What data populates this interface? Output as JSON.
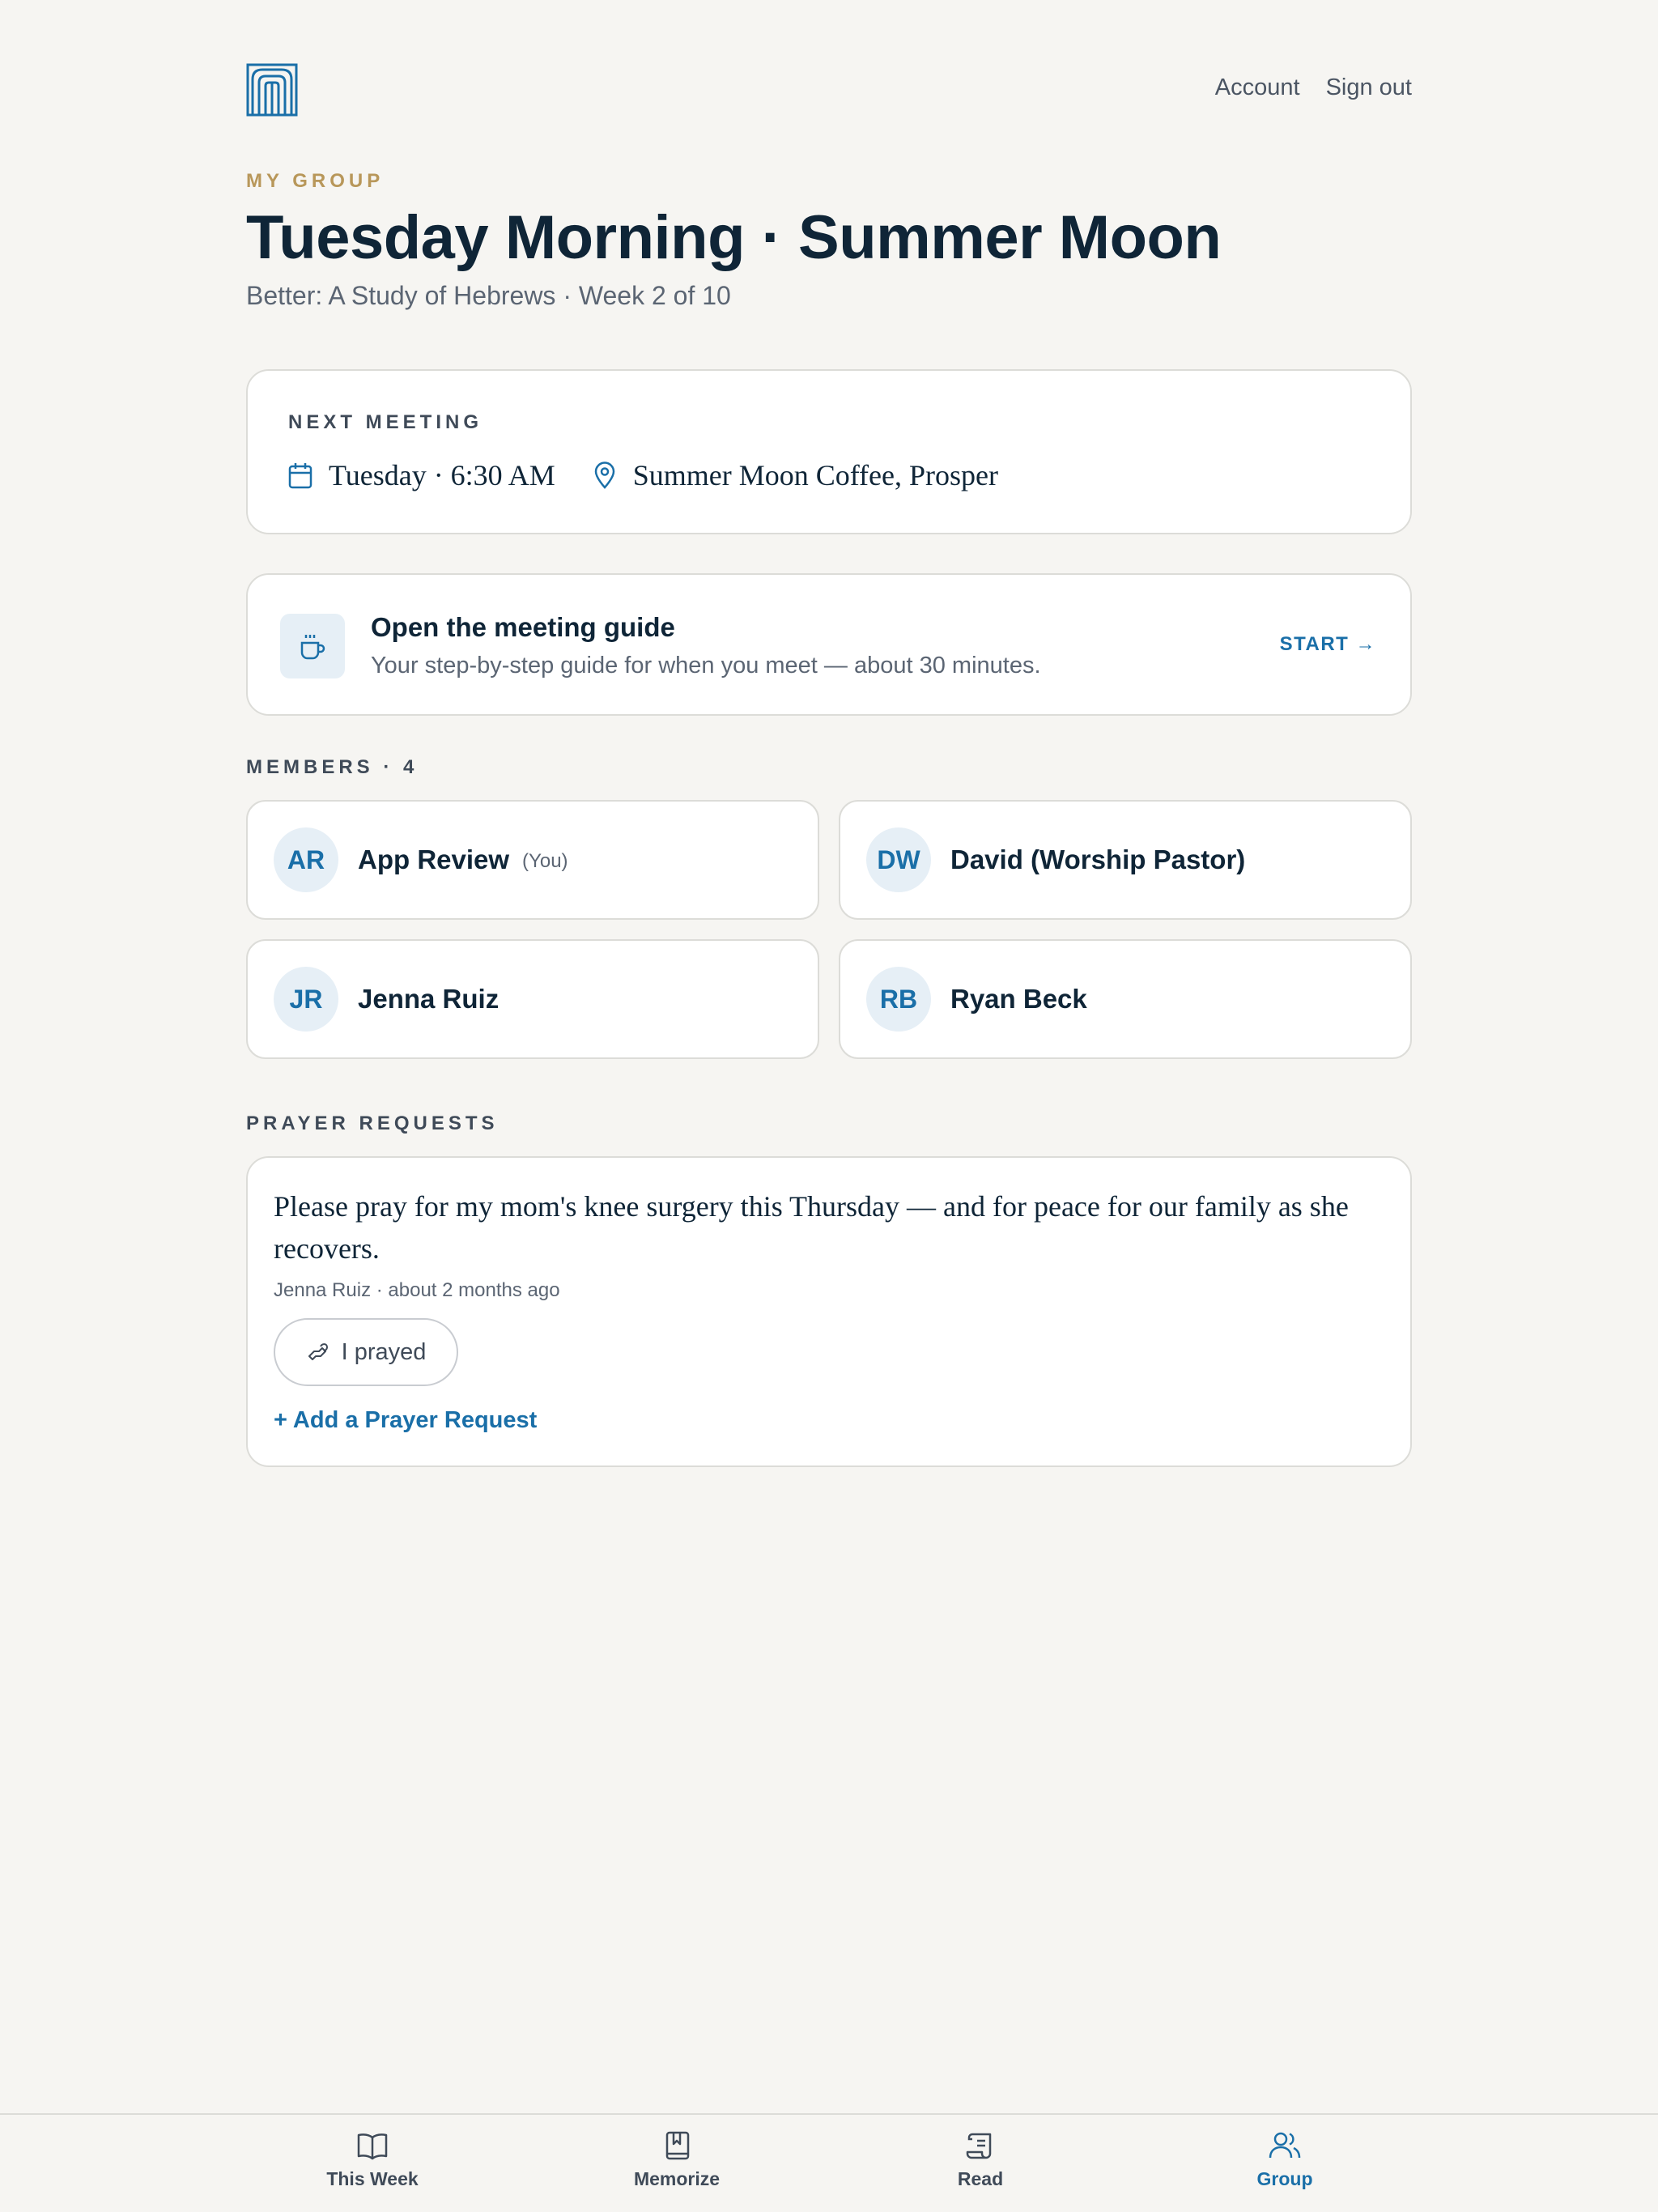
{
  "header": {
    "logo": "brand-logo",
    "nav": [
      "Account",
      "Sign out"
    ]
  },
  "group": {
    "eyebrow": "MY GROUP",
    "title": "Tuesday Morning · Summer Moon",
    "subtitle": "Better: A Study of Hebrews · Week 2 of 10"
  },
  "next_meeting": {
    "label": "NEXT MEETING",
    "time": "Tuesday · 6:30 AM",
    "location": "Summer Moon Coffee, Prosper"
  },
  "guide": {
    "title": "Open the meeting guide",
    "description": "Your step-by-step guide for when you meet — about 30 minutes.",
    "action": "START →"
  },
  "members": {
    "label": "MEMBERS · 4",
    "items": [
      {
        "initials": "AR",
        "name": "App Review",
        "tag": "(You)"
      },
      {
        "initials": "DW",
        "name": "David (Worship Pastor)",
        "tag": ""
      },
      {
        "initials": "JR",
        "name": "Jenna Ruiz",
        "tag": ""
      },
      {
        "initials": "RB",
        "name": "Ryan Beck",
        "tag": ""
      }
    ]
  },
  "prayer": {
    "label": "PRAYER REQUESTS",
    "request_text": "Please pray for my mom's knee surgery this Thursday — and for peace for our family as she recovers.",
    "meta": "Jenna Ruiz · about 2 months ago",
    "prayed_button": "I prayed",
    "add_link": "+ Add a Prayer Request"
  },
  "bottom_nav": {
    "tabs": [
      {
        "label": "This Week",
        "icon": "open-book-icon"
      },
      {
        "label": "Memorize",
        "icon": "bookmark-book-icon"
      },
      {
        "label": "Read",
        "icon": "scroll-icon"
      },
      {
        "label": "Group",
        "icon": "users-icon"
      }
    ],
    "active": "Group"
  },
  "colors": {
    "background": "#f6f5f2",
    "accent": "#1a6fa8",
    "eyebrow": "#b8975a",
    "text_primary": "#0f2537"
  }
}
